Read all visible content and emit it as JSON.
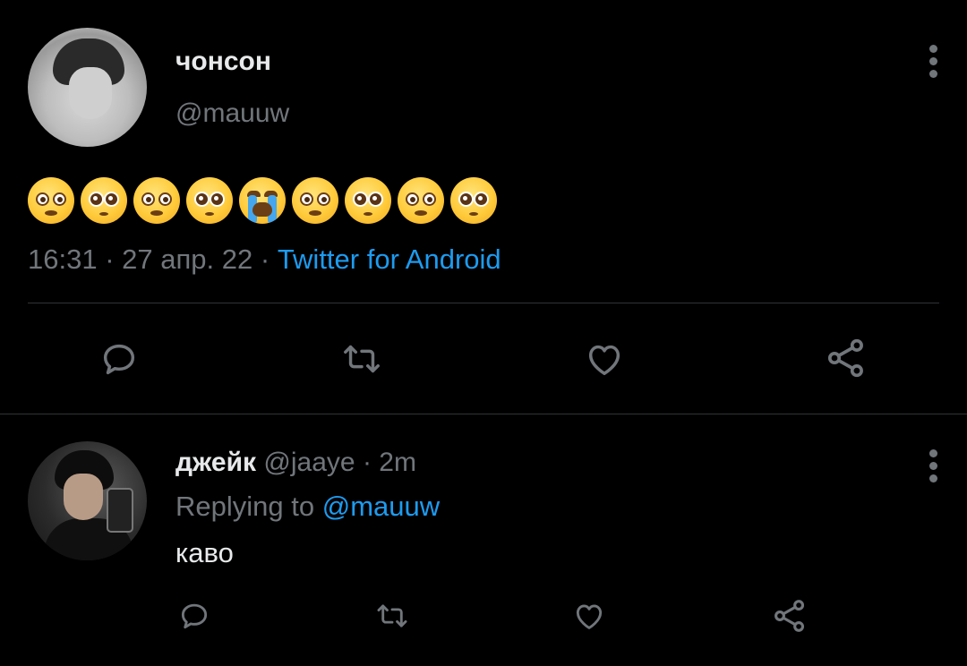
{
  "tweet": {
    "author_name": "чонсон",
    "author_handle": "@mauuw",
    "emojis": [
      "flushed",
      "pleading",
      "flushed",
      "pleading",
      "sob",
      "flushed",
      "pleading",
      "flushed",
      "pleading"
    ],
    "time": "16:31",
    "date": "27 апр. 22",
    "separator": "·",
    "source": "Twitter for Android"
  },
  "reply": {
    "author_name": "джейк",
    "author_handle": "@jaaye",
    "separator": "·",
    "age": "2m",
    "replying_prefix": "Replying to",
    "replying_handle": "@mauuw",
    "text": "каво"
  },
  "actions": [
    "reply-icon",
    "retweet-icon",
    "like-icon",
    "share-icon"
  ],
  "colors": {
    "background": "#000000",
    "text": "#e7e9ea",
    "muted": "#71767b",
    "link": "#1d9bf0"
  }
}
